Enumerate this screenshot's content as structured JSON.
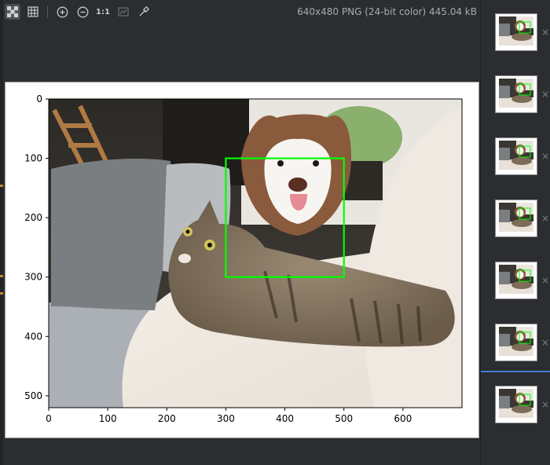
{
  "toolbar": {
    "buttons": [
      {
        "name": "chessboard-icon",
        "glyph": "▦"
      },
      {
        "name": "grid-icon",
        "glyph": "#"
      },
      {
        "name": "zoom-in-icon",
        "glyph": "⊕"
      },
      {
        "name": "zoom-out-icon",
        "glyph": "⊖"
      },
      {
        "name": "actual-size-button",
        "glyph": "1:1"
      },
      {
        "name": "fit-to-window-icon",
        "glyph": "▭"
      },
      {
        "name": "color-picker-icon",
        "glyph": "✎"
      }
    ]
  },
  "file_info": "640x480 PNG (24-bit color) 445.04 kB",
  "thumbnails": {
    "close_glyph": "×",
    "count": 7
  },
  "colors": {
    "bbox": "#00ff00",
    "selection_accent": "#3d7fd1"
  },
  "chart_data": {
    "type": "image-with-bbox",
    "xlim": [
      0,
      700
    ],
    "ylim": [
      520,
      0
    ],
    "x_ticks": [
      0,
      100,
      200,
      300,
      400,
      500,
      600
    ],
    "y_ticks": [
      0,
      100,
      200,
      300,
      400,
      500
    ],
    "bbox": {
      "x1": 300,
      "y1": 100,
      "x2": 500,
      "y2": 300
    }
  }
}
